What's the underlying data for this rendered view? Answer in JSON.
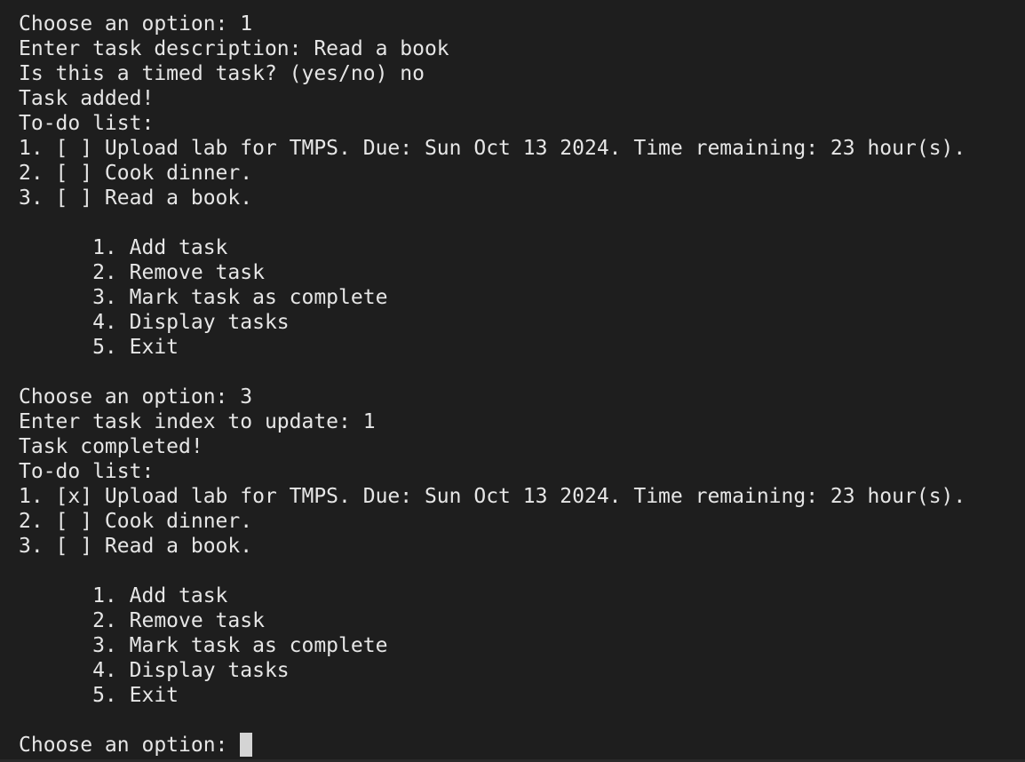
{
  "terminal": {
    "lines": [
      "Choose an option: 1",
      "Enter task description: Read a book",
      "Is this a timed task? (yes/no) no",
      "Task added!",
      "To-do list:",
      "1. [ ] Upload lab for TMPS. Due: Sun Oct 13 2024. Time remaining: 23 hour(s).",
      "2. [ ] Cook dinner.",
      "3. [ ] Read a book.",
      "",
      "      1. Add task",
      "      2. Remove task",
      "      3. Mark task as complete",
      "      4. Display tasks",
      "      5. Exit",
      "",
      "Choose an option: 3",
      "Enter task index to update: 1",
      "Task completed!",
      "To-do list:",
      "1. [x] Upload lab for TMPS. Due: Sun Oct 13 2024. Time remaining: 23 hour(s).",
      "2. [ ] Cook dinner.",
      "3. [ ] Read a book.",
      "",
      "      1. Add task",
      "      2. Remove task",
      "      3. Mark task as complete",
      "      4. Display tasks",
      "      5. Exit",
      ""
    ],
    "prompt": "Choose an option: ",
    "colors": {
      "background": "#1e1e1e",
      "foreground": "#e6e6e6",
      "cursor": "#d4d4d4"
    }
  }
}
